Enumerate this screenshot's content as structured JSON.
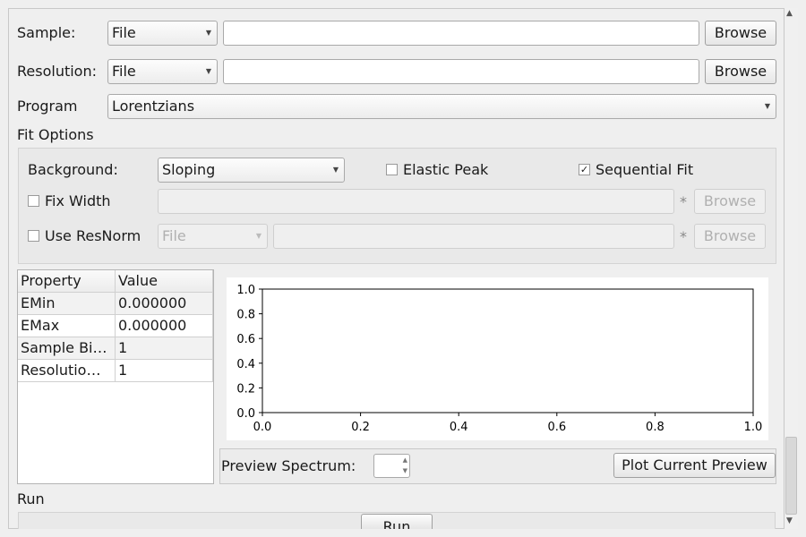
{
  "sample": {
    "label": "Sample:",
    "type": "File",
    "path": "",
    "browse": "Browse"
  },
  "resolution": {
    "label": "Resolution:",
    "type": "File",
    "path": "",
    "browse": "Browse"
  },
  "program": {
    "label": "Program",
    "value": "Lorentzians"
  },
  "fit_options": {
    "title": "Fit Options",
    "background_label": "Background:",
    "background_value": "Sloping",
    "elastic_peak": {
      "label": "Elastic Peak",
      "checked": false
    },
    "sequential_fit": {
      "label": "Sequential Fit",
      "checked": true,
      "check_glyph": "✓"
    },
    "fix_width": {
      "label": "Fix Width",
      "checked": false,
      "star": "*",
      "browse": "Browse"
    },
    "use_resnorm": {
      "label": "Use ResNorm",
      "checked": false,
      "type": "File",
      "star": "*",
      "browse": "Browse"
    }
  },
  "property_table": {
    "headers": [
      "Property",
      "Value"
    ],
    "rows": [
      [
        "EMin",
        "0.000000"
      ],
      [
        "EMax",
        "0.000000"
      ],
      [
        "Sample Bi…",
        "1"
      ],
      [
        "Resolutio…",
        "1"
      ]
    ]
  },
  "chart_data": {
    "type": "line",
    "series": [],
    "xlim": [
      0.0,
      1.0
    ],
    "ylim": [
      0.0,
      1.0
    ],
    "x_ticks": [
      "0.0",
      "0.2",
      "0.4",
      "0.6",
      "0.8",
      "1.0"
    ],
    "y_ticks": [
      "0.0",
      "0.2",
      "0.4",
      "0.6",
      "0.8",
      "1.0"
    ],
    "xlabel": "",
    "ylabel": "",
    "grid": false
  },
  "preview": {
    "spectrum_label": "Preview Spectrum:",
    "spectrum_value": "",
    "plot_button": "Plot Current Preview"
  },
  "run": {
    "title": "Run",
    "button": "Run"
  },
  "icons": {
    "dropdown": "chevron-down-icon",
    "spin_up": "spin-up-icon",
    "spin_down": "spin-down-icon",
    "scroll_up": "scroll-up-arrow-icon",
    "scroll_down": "scroll-down-arrow-icon"
  }
}
